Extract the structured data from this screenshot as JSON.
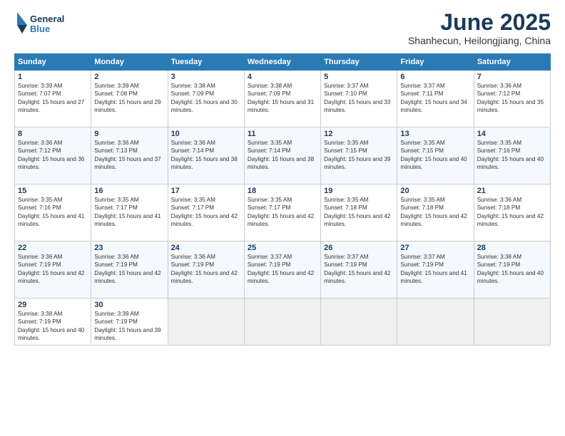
{
  "header": {
    "logo_general": "General",
    "logo_blue": "Blue",
    "month_title": "June 2025",
    "location": "Shanhecun, Heilongjiang, China"
  },
  "weekdays": [
    "Sunday",
    "Monday",
    "Tuesday",
    "Wednesday",
    "Thursday",
    "Friday",
    "Saturday"
  ],
  "weeks": [
    [
      {
        "day": "1",
        "sunrise": "Sunrise: 3:39 AM",
        "sunset": "Sunset: 7:07 PM",
        "daylight": "Daylight: 15 hours and 27 minutes."
      },
      {
        "day": "2",
        "sunrise": "Sunrise: 3:39 AM",
        "sunset": "Sunset: 7:08 PM",
        "daylight": "Daylight: 15 hours and 29 minutes."
      },
      {
        "day": "3",
        "sunrise": "Sunrise: 3:38 AM",
        "sunset": "Sunset: 7:09 PM",
        "daylight": "Daylight: 15 hours and 30 minutes."
      },
      {
        "day": "4",
        "sunrise": "Sunrise: 3:38 AM",
        "sunset": "Sunset: 7:09 PM",
        "daylight": "Daylight: 15 hours and 31 minutes."
      },
      {
        "day": "5",
        "sunrise": "Sunrise: 3:37 AM",
        "sunset": "Sunset: 7:10 PM",
        "daylight": "Daylight: 15 hours and 33 minutes."
      },
      {
        "day": "6",
        "sunrise": "Sunrise: 3:37 AM",
        "sunset": "Sunset: 7:11 PM",
        "daylight": "Daylight: 15 hours and 34 minutes."
      },
      {
        "day": "7",
        "sunrise": "Sunrise: 3:36 AM",
        "sunset": "Sunset: 7:12 PM",
        "daylight": "Daylight: 15 hours and 35 minutes."
      }
    ],
    [
      {
        "day": "8",
        "sunrise": "Sunrise: 3:36 AM",
        "sunset": "Sunset: 7:12 PM",
        "daylight": "Daylight: 15 hours and 36 minutes."
      },
      {
        "day": "9",
        "sunrise": "Sunrise: 3:36 AM",
        "sunset": "Sunset: 7:13 PM",
        "daylight": "Daylight: 15 hours and 37 minutes."
      },
      {
        "day": "10",
        "sunrise": "Sunrise: 3:36 AM",
        "sunset": "Sunset: 7:14 PM",
        "daylight": "Daylight: 15 hours and 38 minutes."
      },
      {
        "day": "11",
        "sunrise": "Sunrise: 3:35 AM",
        "sunset": "Sunset: 7:14 PM",
        "daylight": "Daylight: 15 hours and 38 minutes."
      },
      {
        "day": "12",
        "sunrise": "Sunrise: 3:35 AM",
        "sunset": "Sunset: 7:15 PM",
        "daylight": "Daylight: 15 hours and 39 minutes."
      },
      {
        "day": "13",
        "sunrise": "Sunrise: 3:35 AM",
        "sunset": "Sunset: 7:15 PM",
        "daylight": "Daylight: 15 hours and 40 minutes."
      },
      {
        "day": "14",
        "sunrise": "Sunrise: 3:35 AM",
        "sunset": "Sunset: 7:16 PM",
        "daylight": "Daylight: 15 hours and 40 minutes."
      }
    ],
    [
      {
        "day": "15",
        "sunrise": "Sunrise: 3:35 AM",
        "sunset": "Sunset: 7:16 PM",
        "daylight": "Daylight: 15 hours and 41 minutes."
      },
      {
        "day": "16",
        "sunrise": "Sunrise: 3:35 AM",
        "sunset": "Sunset: 7:17 PM",
        "daylight": "Daylight: 15 hours and 41 minutes."
      },
      {
        "day": "17",
        "sunrise": "Sunrise: 3:35 AM",
        "sunset": "Sunset: 7:17 PM",
        "daylight": "Daylight: 15 hours and 42 minutes."
      },
      {
        "day": "18",
        "sunrise": "Sunrise: 3:35 AM",
        "sunset": "Sunset: 7:17 PM",
        "daylight": "Daylight: 15 hours and 42 minutes."
      },
      {
        "day": "19",
        "sunrise": "Sunrise: 3:35 AM",
        "sunset": "Sunset: 7:18 PM",
        "daylight": "Daylight: 15 hours and 42 minutes."
      },
      {
        "day": "20",
        "sunrise": "Sunrise: 3:35 AM",
        "sunset": "Sunset: 7:18 PM",
        "daylight": "Daylight: 15 hours and 42 minutes."
      },
      {
        "day": "21",
        "sunrise": "Sunrise: 3:36 AM",
        "sunset": "Sunset: 7:18 PM",
        "daylight": "Daylight: 15 hours and 42 minutes."
      }
    ],
    [
      {
        "day": "22",
        "sunrise": "Sunrise: 3:36 AM",
        "sunset": "Sunset: 7:19 PM",
        "daylight": "Daylight: 15 hours and 42 minutes."
      },
      {
        "day": "23",
        "sunrise": "Sunrise: 3:36 AM",
        "sunset": "Sunset: 7:19 PM",
        "daylight": "Daylight: 15 hours and 42 minutes."
      },
      {
        "day": "24",
        "sunrise": "Sunrise: 3:36 AM",
        "sunset": "Sunset: 7:19 PM",
        "daylight": "Daylight: 15 hours and 42 minutes."
      },
      {
        "day": "25",
        "sunrise": "Sunrise: 3:37 AM",
        "sunset": "Sunset: 7:19 PM",
        "daylight": "Daylight: 15 hours and 42 minutes."
      },
      {
        "day": "26",
        "sunrise": "Sunrise: 3:37 AM",
        "sunset": "Sunset: 7:19 PM",
        "daylight": "Daylight: 15 hours and 42 minutes."
      },
      {
        "day": "27",
        "sunrise": "Sunrise: 3:37 AM",
        "sunset": "Sunset: 7:19 PM",
        "daylight": "Daylight: 15 hours and 41 minutes."
      },
      {
        "day": "28",
        "sunrise": "Sunrise: 3:38 AM",
        "sunset": "Sunset: 7:19 PM",
        "daylight": "Daylight: 15 hours and 40 minutes."
      }
    ],
    [
      {
        "day": "29",
        "sunrise": "Sunrise: 3:38 AM",
        "sunset": "Sunset: 7:19 PM",
        "daylight": "Daylight: 15 hours and 40 minutes."
      },
      {
        "day": "30",
        "sunrise": "Sunrise: 3:39 AM",
        "sunset": "Sunset: 7:19 PM",
        "daylight": "Daylight: 15 hours and 39 minutes."
      },
      null,
      null,
      null,
      null,
      null
    ]
  ]
}
